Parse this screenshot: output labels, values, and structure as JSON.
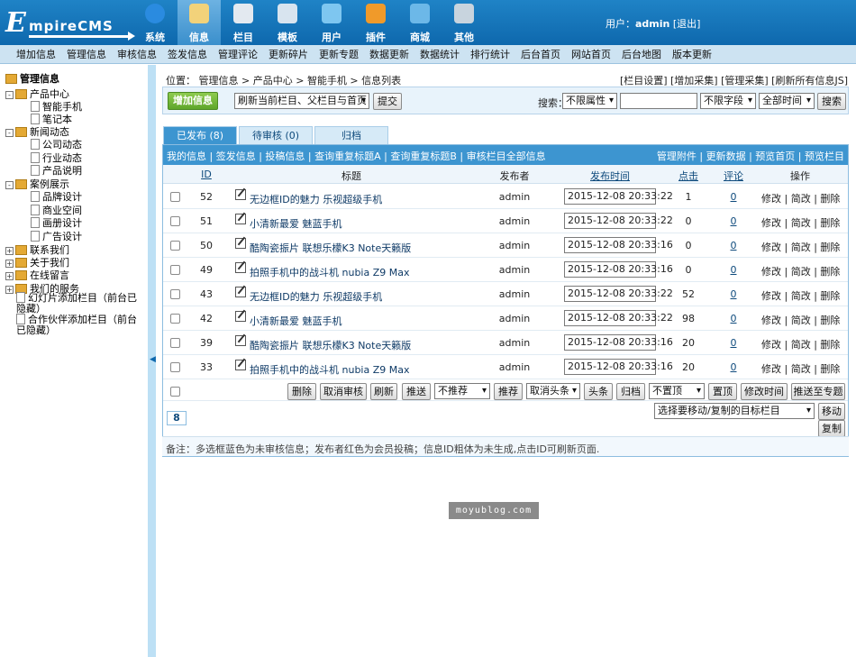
{
  "logo": {
    "big": "E",
    "rest": "mpireCMS"
  },
  "topnav": [
    {
      "label": "系统",
      "icon": "globe-icon",
      "color": "#2a8be0"
    },
    {
      "label": "信息",
      "icon": "edit-icon",
      "color": "#f2d27a",
      "active": true
    },
    {
      "label": "栏目",
      "icon": "folder-icon",
      "color": "#e3e9f0"
    },
    {
      "label": "模板",
      "icon": "window-icon",
      "color": "#d8e4ef"
    },
    {
      "label": "用户",
      "icon": "user-icon",
      "color": "#7ec6f0"
    },
    {
      "label": "插件",
      "icon": "tools-icon",
      "color": "#f09a2a"
    },
    {
      "label": "商城",
      "icon": "card-icon",
      "color": "#6cb8e8"
    },
    {
      "label": "其他",
      "icon": "gear-icon",
      "color": "#c8d4de"
    }
  ],
  "user": {
    "prefix": "用户：",
    "name": "admin",
    "logout": "[退出]"
  },
  "menu": [
    "增加信息",
    "管理信息",
    "审核信息",
    "签发信息",
    "管理评论",
    "更新碎片",
    "更新专题",
    "数据更新",
    "数据统计",
    "排行统计",
    "后台首页",
    "网站首页",
    "后台地图",
    "版本更新"
  ],
  "sidebar": {
    "root": "管理信息",
    "items": [
      {
        "label": "产品中心"
      },
      {
        "label": "智能手机"
      },
      {
        "label": "笔记本"
      },
      {
        "label": "新闻动态"
      },
      {
        "label": "公司动态"
      },
      {
        "label": "行业动态"
      },
      {
        "label": "产品说明"
      },
      {
        "label": "案例展示"
      },
      {
        "label": "品牌设计"
      },
      {
        "label": "商业空间"
      },
      {
        "label": "画册设计"
      },
      {
        "label": "广告设计"
      },
      {
        "label": "联系我们"
      },
      {
        "label": "关于我们"
      },
      {
        "label": "在线留言"
      },
      {
        "label": "我们的服务"
      },
      {
        "label": "幻灯片添加栏目（前台已隐藏）"
      },
      {
        "label": "合作伙伴添加栏目（前台已隐藏）"
      }
    ]
  },
  "breadcrumb": {
    "prefix": "位置：",
    "parts": [
      "管理信息",
      "产品中心",
      "智能手机",
      "信息列表"
    ],
    "sep": " > "
  },
  "breadcrumb_links": "[栏目设置] [增加采集] [管理采集] [刷新所有信息JS]",
  "toolbar": {
    "add_label": "增加信息",
    "refresh_select": "刷新当前栏目、父栏目与首页",
    "submit_label": "提交",
    "search_label": "搜索：",
    "attr_select": "不限属性",
    "field_select": "不限字段",
    "time_select": "全部时间",
    "search_button": "搜索"
  },
  "tabs": [
    "已发布 (8)",
    "待审核 (0)",
    "归档"
  ],
  "subbar": {
    "left": "我的信息 | 签发信息 | 投稿信息 | 查询重复标题A | 查询重复标题B | 审核栏目全部信息",
    "right": "管理附件 | 更新数据 | 预览首页 | 预览栏目"
  },
  "headers": {
    "id": "ID",
    "title": "标题",
    "publisher": "发布者",
    "time": "发布时间",
    "clicks": "点击",
    "comments": "评论",
    "ops": "操作"
  },
  "rows": [
    {
      "id": "52",
      "title": "无边框ID的魅力 乐视超级手机",
      "publisher": "admin",
      "time": "2015-12-08 20:33:22",
      "clicks": "1",
      "comments": "0",
      "ops": "修改 | 简改 | 删除"
    },
    {
      "id": "51",
      "title": "小清新最爱 魅蓝手机",
      "publisher": "admin",
      "time": "2015-12-08 20:33:22",
      "clicks": "0",
      "comments": "0",
      "ops": "修改 | 简改 | 删除"
    },
    {
      "id": "50",
      "title": "酷陶瓷振片 联想乐檬K3 Note天籁版",
      "publisher": "admin",
      "time": "2015-12-08 20:33:16",
      "clicks": "0",
      "comments": "0",
      "ops": "修改 | 简改 | 删除"
    },
    {
      "id": "49",
      "title": "拍照手机中的战斗机 nubia Z9 Max",
      "publisher": "admin",
      "time": "2015-12-08 20:33:16",
      "clicks": "0",
      "comments": "0",
      "ops": "修改 | 简改 | 删除"
    },
    {
      "id": "43",
      "title": "无边框ID的魅力 乐视超级手机",
      "publisher": "admin",
      "time": "2015-12-08 20:33:22",
      "clicks": "52",
      "comments": "0",
      "ops": "修改 | 简改 | 删除"
    },
    {
      "id": "42",
      "title": "小清新最爱 魅蓝手机",
      "publisher": "admin",
      "time": "2015-12-08 20:33:22",
      "clicks": "98",
      "comments": "0",
      "ops": "修改 | 简改 | 删除"
    },
    {
      "id": "39",
      "title": "酷陶瓷振片 联想乐檬K3 Note天籁版",
      "publisher": "admin",
      "time": "2015-12-08 20:33:16",
      "clicks": "20",
      "comments": "0",
      "ops": "修改 | 简改 | 删除"
    },
    {
      "id": "33",
      "title": "拍照手机中的战斗机 nubia Z9 Max",
      "publisher": "admin",
      "time": "2015-12-08 20:33:16",
      "clicks": "20",
      "comments": "0",
      "ops": "修改 | 简改 | 删除"
    }
  ],
  "actions": {
    "delete": "删除",
    "unaudit": "取消审核",
    "refresh": "刷新",
    "push": "推送",
    "recommend_select": "不推荐",
    "recommend": "推荐",
    "headline_select": "取消头条",
    "headline": "头条",
    "archive": "归档",
    "top_select": "不置顶",
    "top": "置顶",
    "change_time": "修改时间",
    "push_topic": "推送至专题"
  },
  "move": {
    "select": "选择要移动/复制的目标栏目",
    "move_label": "移动",
    "copy_label": "复制"
  },
  "pager": "8",
  "note": "备注：多选框蓝色为未审核信息；发布者红色为会员投稿；信息ID粗体为未生成,点击ID可刷新页面.",
  "watermark": "moyublog.com"
}
